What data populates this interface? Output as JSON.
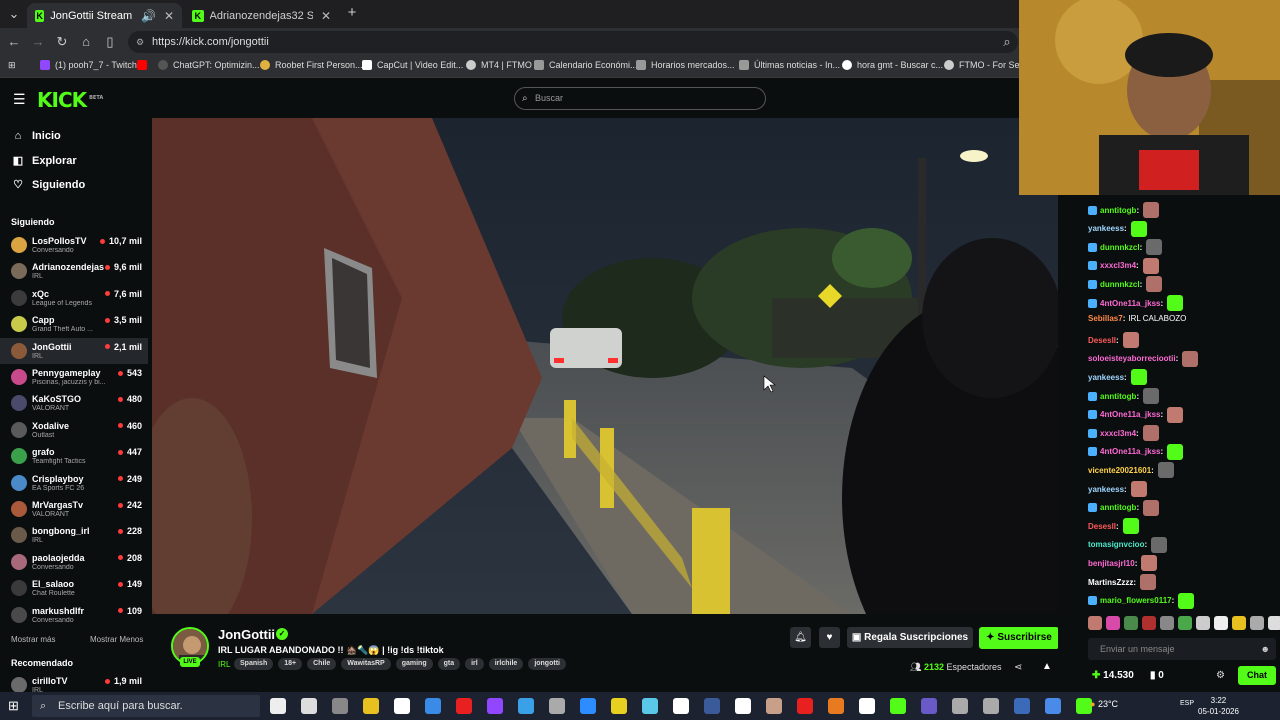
{
  "browser": {
    "tabs": [
      {
        "title": "JonGottii Stream - Watch Live",
        "active": true
      },
      {
        "title": "Adrianozendejas32 Stream - Watch",
        "active": false
      }
    ],
    "url": "https://kick.com/jongottii",
    "bookmarks": [
      "(1) pooh7_7 - Twitch",
      "ChatGPT: Optimizin...",
      "Roobet First Person...",
      "CapCut | Video Edit...",
      "MT4 | FTMO",
      "Calendario Económi...",
      "Horarios mercados...",
      "Últimas noticias - In...",
      "hora gmt - Buscar c...",
      "FTMO - For Serio"
    ]
  },
  "kick": {
    "logo": "KICK",
    "logo_beta": "BETA",
    "search_placeholder": "Buscar"
  },
  "sidebar": {
    "nav": [
      {
        "label": "Inicio",
        "icon": "home-icon"
      },
      {
        "label": "Explorar",
        "icon": "explore-icon"
      },
      {
        "label": "Siguiendo",
        "icon": "heart-icon"
      }
    ],
    "following_title": "Siguiendo",
    "following": [
      {
        "name": "LosPollosTV",
        "category": "Conversando",
        "viewers": "10,7 mil",
        "color": "#d9a441"
      },
      {
        "name": "Adrianozendejas32",
        "category": "IRL",
        "viewers": "9,6 mil",
        "color": "#7a6a5a"
      },
      {
        "name": "xQc",
        "category": "League of Legends",
        "viewers": "7,6 mil",
        "color": "#3b3b3b"
      },
      {
        "name": "Capp",
        "category": "Grand Theft Auto ...",
        "viewers": "3,5 mil",
        "color": "#c9c94a"
      },
      {
        "name": "JonGottii",
        "category": "IRL",
        "viewers": "2,1 mil",
        "color": "#8a5a3a"
      },
      {
        "name": "Pennygameplay",
        "category": "Piscinas, jacuzzis y bi...",
        "viewers": "543",
        "color": "#c84a8a"
      },
      {
        "name": "KaKoSTGO",
        "category": "VALORANT",
        "viewers": "480",
        "color": "#4a4a6a"
      },
      {
        "name": "Xodalive",
        "category": "Outlast",
        "viewers": "460",
        "color": "#5a5a5a"
      },
      {
        "name": "grafo",
        "category": "Teamfight Tactics",
        "viewers": "447",
        "color": "#3aa04a"
      },
      {
        "name": "Crisplayboy",
        "category": "EA Sports FC 26",
        "viewers": "249",
        "color": "#4a8ac8"
      },
      {
        "name": "MrVargasTv",
        "category": "VALORANT",
        "viewers": "242",
        "color": "#aa5a3a"
      },
      {
        "name": "bongbong_irl",
        "category": "IRL",
        "viewers": "228",
        "color": "#6a5a4a"
      },
      {
        "name": "paolaojedda",
        "category": "Conversando",
        "viewers": "208",
        "color": "#a86a7a"
      },
      {
        "name": "El_salaoo",
        "category": "Chat Roulette",
        "viewers": "149",
        "color": "#3a3a3a"
      },
      {
        "name": "markushdlfr",
        "category": "Conversando",
        "viewers": "109",
        "color": "#4a4a4a"
      }
    ],
    "show_more": "Mostrar más",
    "show_less": "Mostrar Menos",
    "recommended_title": "Recomendado",
    "recommended": [
      {
        "name": "cirilloTV",
        "category": "IRL",
        "viewers": "1,9 mil",
        "color": "#6a6a6a"
      }
    ]
  },
  "stream": {
    "streamer": "JonGottii",
    "live_badge": "LIVE",
    "title": "IRL LUGAR ABANDONADO !! 🏚️🔦😱 | !ig !ds !tiktok",
    "category": "IRL",
    "tags": [
      "Spanish",
      "18+",
      "Chile",
      "WawitasRP",
      "gaming",
      "gta",
      "irl",
      "irlchile",
      "jongotti"
    ],
    "gift_label": "Regala Suscripciones",
    "subscribe_label": "Suscribirse",
    "viewers_count": "2132",
    "viewers_label": "Espectadores"
  },
  "chat": {
    "messages": [
      {
        "user": "anntitogb",
        "color": "#53fc18",
        "text": "",
        "badges": true
      },
      {
        "user": "yankeess",
        "color": "#9fd8ff",
        "text": "",
        "badges": false
      },
      {
        "user": "dunnnkzcl",
        "color": "#53fc18",
        "text": "",
        "badges": true
      },
      {
        "user": "xxxcl3m4",
        "color": "#ff6ad5",
        "text": "",
        "badges": true
      },
      {
        "user": "dunnnkzcl",
        "color": "#53fc18",
        "text": "",
        "badges": true
      },
      {
        "user": "4ntOne11a_jkss",
        "color": "#ff6ad5",
        "text": "",
        "badges": true
      },
      {
        "user": "Sebillas7",
        "color": "#ff8a4a",
        "text": "IRL CALABOZO",
        "badges": false
      },
      {
        "user": "Desesll",
        "color": "#ff5a5a",
        "text": "",
        "badges": false
      },
      {
        "user": "soloeisteyaborreciootii",
        "color": "#ff6ad5",
        "text": "",
        "badges": false
      },
      {
        "user": "yankeess",
        "color": "#9fd8ff",
        "text": "",
        "badges": false
      },
      {
        "user": "anntitogb",
        "color": "#53fc18",
        "text": "",
        "badges": true
      },
      {
        "user": "4ntOne11a_jkss",
        "color": "#ff6ad5",
        "text": "",
        "badges": true
      },
      {
        "user": "xxxcl3m4",
        "color": "#ff6ad5",
        "text": "",
        "badges": true
      },
      {
        "user": "4ntOne11a_jkss",
        "color": "#ff6ad5",
        "text": "",
        "badges": true
      },
      {
        "user": "vicente20021601",
        "color": "#ffd34a",
        "text": "",
        "badges": false
      },
      {
        "user": "yankeess",
        "color": "#9fd8ff",
        "text": "",
        "badges": false
      },
      {
        "user": "anntitogb",
        "color": "#53fc18",
        "text": "",
        "badges": true
      },
      {
        "user": "Desesll",
        "color": "#ff5a5a",
        "text": "",
        "badges": false
      },
      {
        "user": "tomasignvcioo",
        "color": "#4ae8c8",
        "text": "",
        "badges": false
      },
      {
        "user": "benjitasjrl10",
        "color": "#ff6ad5",
        "text": "",
        "badges": false
      },
      {
        "user": "MartinsZzzz",
        "color": "#ffffff",
        "text": "",
        "badges": false
      },
      {
        "user": "mario_flowers0117",
        "color": "#53fc18",
        "text": "",
        "badges": true
      }
    ],
    "input_placeholder": "Enviar un mensaje",
    "points": "14.530",
    "points2": "0",
    "chat_button": "Chat"
  },
  "taskbar": {
    "search_placeholder": "Escribe aquí para buscar.",
    "temperature": "23°C",
    "language": "ESP",
    "time": "3:22",
    "date": "05-01-2026"
  }
}
